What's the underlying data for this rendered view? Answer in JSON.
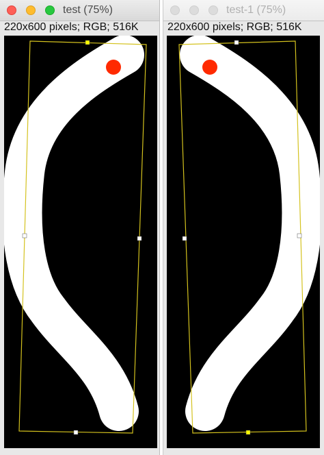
{
  "windows": [
    {
      "title": "test (75%)",
      "info": "220x600 pixels; RGB; 516K",
      "active": true
    },
    {
      "title": "test-1 (75%)",
      "info": "220x600 pixels; RGB; 516K",
      "active": false
    }
  ],
  "colors": {
    "background": "#000000",
    "shape": "#ffffff",
    "marker": "#ff2a00",
    "roi": "#d4c21e",
    "handle_active": "#ffff00",
    "handle": "#ffffff"
  }
}
